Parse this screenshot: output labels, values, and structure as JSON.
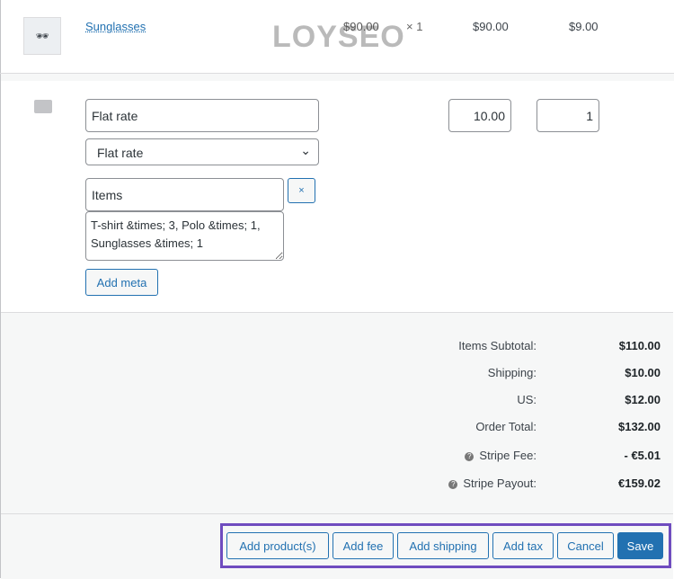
{
  "watermark": "LOYSEO",
  "item": {
    "name": "Sunglasses",
    "cost": "$90.00",
    "qty": "× 1",
    "total": "$90.00",
    "tax": "$9.00",
    "icon": "sunglasses-icon"
  },
  "shipping": {
    "icon": "truck-icon",
    "name": "Flat rate",
    "method": "Flat rate",
    "cost": "10.00",
    "tax": "1",
    "meta_key": "Items",
    "meta_value": "T-shirt &times; 3, Polo &times; 1, Sunglasses &times; 1",
    "remove": "×",
    "add_meta": "Add meta"
  },
  "totals": [
    {
      "label": "Items Subtotal:",
      "value": "$110.00"
    },
    {
      "label": "Shipping:",
      "value": "$10.00"
    },
    {
      "label": "US:",
      "value": "$12.00"
    },
    {
      "label": "Order Total:",
      "value": "$132.00"
    },
    {
      "label": "Stripe Fee:",
      "value": "- €5.01",
      "help": true
    },
    {
      "label": "Stripe Payout:",
      "value": "€159.02",
      "help": true
    }
  ],
  "actions": {
    "add_products": "Add product(s)",
    "add_fee": "Add fee",
    "add_shipping": "Add shipping",
    "add_tax": "Add tax",
    "cancel": "Cancel",
    "save": "Save"
  },
  "colors": {
    "accent": "#2271b1",
    "highlight": "#6f4cbf"
  }
}
